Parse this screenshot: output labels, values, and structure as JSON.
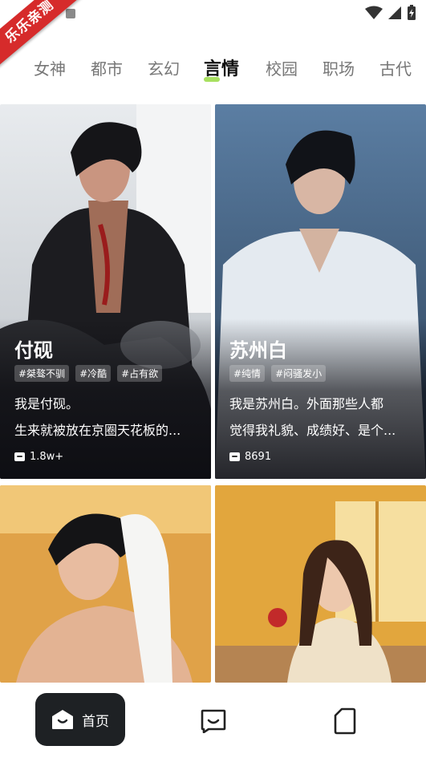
{
  "status": {
    "badge_text": "乐乐亲测",
    "icons": [
      "wifi-icon",
      "signal-icon",
      "battery-charging-icon"
    ]
  },
  "tabs": [
    {
      "label": "女神"
    },
    {
      "label": "都市"
    },
    {
      "label": "玄幻"
    },
    {
      "label": "言情",
      "active": true
    },
    {
      "label": "校园"
    },
    {
      "label": "职场"
    },
    {
      "label": "古代"
    }
  ],
  "cards": [
    {
      "name": "付砚",
      "tags": [
        "#桀骜不驯",
        "#冷酷",
        "#占有欲"
      ],
      "line1": "我是付砚。",
      "line2": "生来就被放在京圈天花板的...",
      "count": "1.8w+",
      "image": "young man in black shirt on motorcycle"
    },
    {
      "name": "苏州白",
      "tags": [
        "#纯情",
        "#闷骚发小"
      ],
      "line1": "我是苏州白。外面那些人都",
      "line2": "觉得我礼貌、成绩好、是个...",
      "count": "8691",
      "image": "young man in wet white shirt in rain"
    },
    {
      "image": "young man with towel in warm room"
    },
    {
      "image": "young woman holding apple by window"
    }
  ],
  "bottom_nav": {
    "home_label": "首页",
    "icons": [
      "home-icon",
      "chat-icon",
      "profile-icon"
    ]
  },
  "colors": {
    "active_underline": "#a8e060",
    "nav_active_bg": "#1e2124",
    "badge_red": "#d62b2b"
  }
}
